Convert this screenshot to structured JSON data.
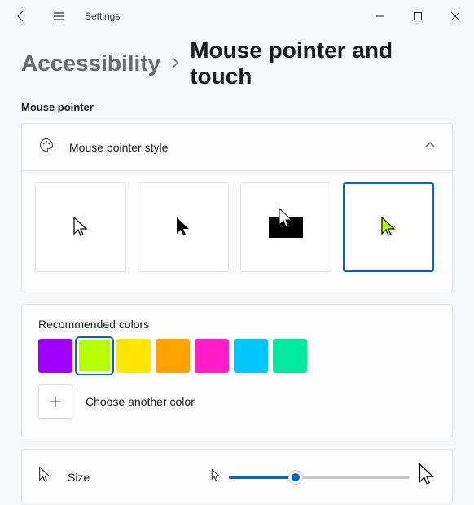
{
  "titlebar": {
    "title": "Settings"
  },
  "breadcrumb": {
    "parent": "Accessibility",
    "current": "Mouse pointer and touch"
  },
  "section": {
    "label": "Mouse pointer"
  },
  "style_card": {
    "title": "Mouse pointer style",
    "options": [
      {
        "id": "white",
        "selected": false
      },
      {
        "id": "black",
        "selected": false
      },
      {
        "id": "inverted",
        "selected": false
      },
      {
        "id": "custom",
        "selected": true
      }
    ]
  },
  "colors": {
    "label": "Recommended colors",
    "swatches": [
      {
        "hex": "#a000ff",
        "selected": false
      },
      {
        "hex": "#b4ff00",
        "selected": true
      },
      {
        "hex": "#ffe600",
        "selected": false
      },
      {
        "hex": "#ffa200",
        "selected": false
      },
      {
        "hex": "#ff1dc7",
        "selected": false
      },
      {
        "hex": "#00c8ff",
        "selected": false
      },
      {
        "hex": "#00e9a1",
        "selected": false
      }
    ],
    "choose_label": "Choose another color"
  },
  "size": {
    "label": "Size",
    "value_pct": 37
  }
}
